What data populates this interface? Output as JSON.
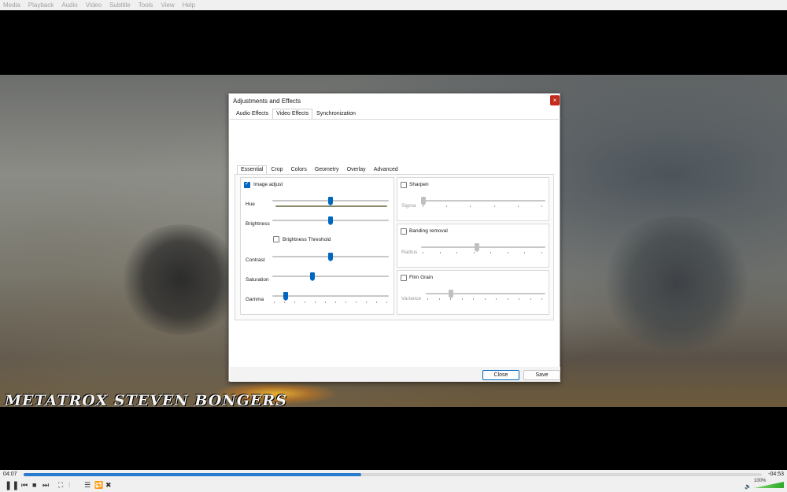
{
  "menu": [
    "Media",
    "Playback",
    "Audio",
    "Video",
    "Subtitle",
    "Tools",
    "View",
    "Help"
  ],
  "video": {
    "caption": "METATROX   STEVEN BONGERS"
  },
  "dialog": {
    "title": "Adjustments and Effects",
    "close_glyph": "×",
    "top_tabs": [
      "Audio Effects",
      "Video Effects",
      "Synchronization"
    ],
    "active_top_tab": "Video Effects",
    "inner_tabs": [
      "Essential",
      "Crop",
      "Colors",
      "Geometry",
      "Overlay",
      "Advanced"
    ],
    "active_inner_tab": "Essential",
    "image_adjust": {
      "label": "Image adjust",
      "checked": true,
      "hue_label": "Hue",
      "brightness_label": "Brightness",
      "brightness_threshold_label": "Brightness Threshold",
      "contrast_label": "Contrast",
      "saturation_label": "Saturation",
      "gamma_label": "Gamma",
      "hue_level": 0.5,
      "brightness_level": 0.5,
      "contrast_level": 0.5,
      "saturation_level": 0.34,
      "gamma_level": 0.1
    },
    "sharpen": {
      "label": "Sharpen",
      "param_label": "Sigma",
      "level": 0.0
    },
    "banding": {
      "label": "Banding removal",
      "param_label": "Radius",
      "level": 0.45
    },
    "film_grain": {
      "label": "Film Grain",
      "param_label": "Variance",
      "level": 0.2
    },
    "close_button": "Close",
    "save_button": "Save"
  },
  "player": {
    "elapsed": "04:07",
    "remaining": "-04:53",
    "progress": 0.457,
    "volume": "100%"
  }
}
